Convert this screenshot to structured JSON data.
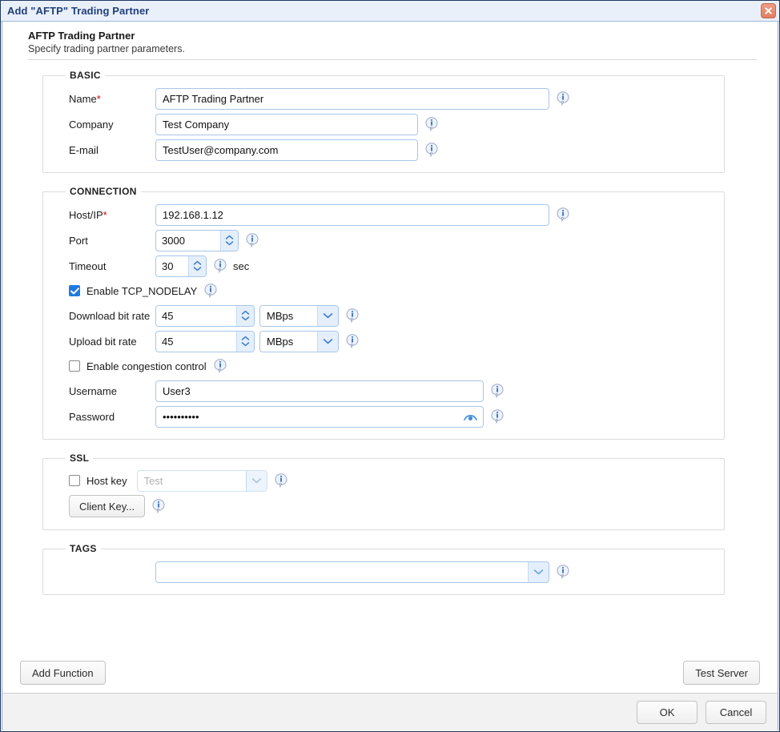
{
  "titlebar": {
    "title": "Add \"AFTP\" Trading Partner",
    "close_icon": "close-icon"
  },
  "header": {
    "title": "AFTP Trading Partner",
    "subtitle": "Specify trading partner parameters."
  },
  "groups": {
    "basic": {
      "legend": "BASIC",
      "name": {
        "label": "Name",
        "required": "*",
        "value": "AFTP Trading Partner"
      },
      "company": {
        "label": "Company",
        "value": "Test Company"
      },
      "email": {
        "label": "E-mail",
        "value": "TestUser@company.com"
      }
    },
    "connection": {
      "legend": "CONNECTION",
      "host": {
        "label": "Host/IP",
        "required": "*",
        "value": "192.168.1.12"
      },
      "port": {
        "label": "Port",
        "value": "3000"
      },
      "timeout": {
        "label": "Timeout",
        "value": "30",
        "unit": "sec"
      },
      "tcp_nodelay": {
        "label": "Enable TCP_NODELAY",
        "checked": true
      },
      "download": {
        "label": "Download bit rate",
        "value": "45",
        "unit": "MBps"
      },
      "upload": {
        "label": "Upload bit rate",
        "value": "45",
        "unit": "MBps"
      },
      "congestion": {
        "label": "Enable congestion control",
        "checked": false
      },
      "username": {
        "label": "Username",
        "value": "User3"
      },
      "password": {
        "label": "Password",
        "value": "••••••••••",
        "reveal_icon": "eye-icon"
      }
    },
    "ssl": {
      "legend": "SSL",
      "host_key": {
        "label": "Host key",
        "checked": false,
        "select_value": "Test",
        "disabled": true
      },
      "client_key_button": "Client Key..."
    },
    "tags": {
      "legend": "TAGS",
      "tags": {
        "label": "Tags",
        "value": ""
      }
    }
  },
  "actions": {
    "add_function": "Add Function",
    "test_server": "Test Server"
  },
  "footer": {
    "ok": "OK",
    "cancel": "Cancel"
  },
  "colors": {
    "title_text": "#1f3f7a",
    "titlebar_bg": "#eaf0fa",
    "accent_blue": "#1d7ae0",
    "required_red": "#e00000",
    "close_button": "#e07d60",
    "field_border": "#a8c6e8"
  }
}
